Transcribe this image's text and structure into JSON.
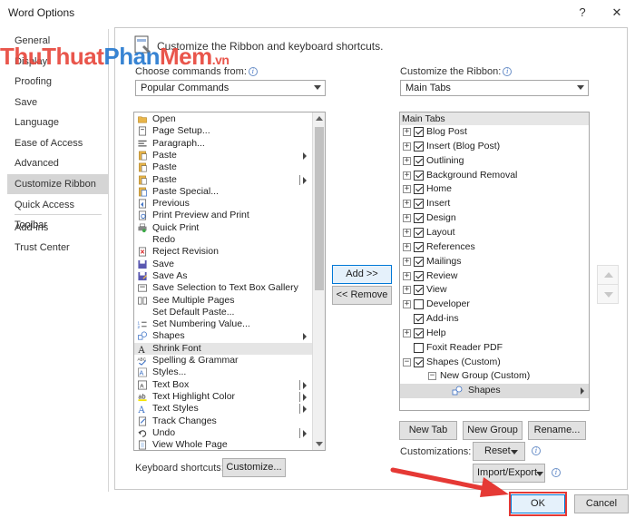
{
  "window": {
    "title": "Word Options",
    "help": "?",
    "close": "✕"
  },
  "nav": [
    {
      "label": "General"
    },
    {
      "label": "Display"
    },
    {
      "label": "Proofing"
    },
    {
      "label": "Save"
    },
    {
      "label": "Language"
    },
    {
      "label": "Ease of Access"
    },
    {
      "label": "Advanced"
    },
    {
      "label": "Customize Ribbon",
      "selected": true
    },
    {
      "label": "Quick Access Toolbar"
    },
    {
      "label": "Add-ins"
    },
    {
      "label": "Trust Center"
    }
  ],
  "header": {
    "text": "Customize the Ribbon and keyboard shortcuts."
  },
  "left": {
    "choose_label": "Choose commands from:",
    "choose_value": "Popular Commands",
    "commands": [
      {
        "label": "Open",
        "icon": "folder-icon"
      },
      {
        "label": "Page Setup...",
        "icon": "page-setup-icon"
      },
      {
        "label": "Paragraph...",
        "icon": "paragraph-icon"
      },
      {
        "label": "Paste",
        "icon": "paste-icon",
        "submenu": true
      },
      {
        "label": "Paste",
        "icon": "paste-icon"
      },
      {
        "label": "Paste",
        "icon": "paste-icon",
        "split": true
      },
      {
        "label": "Paste Special...",
        "icon": "paste-special-icon"
      },
      {
        "label": "Previous",
        "icon": "previous-icon"
      },
      {
        "label": "Print Preview and Print",
        "icon": "print-preview-icon"
      },
      {
        "label": "Quick Print",
        "icon": "quick-print-icon"
      },
      {
        "label": "Redo",
        "icon": "redo-icon"
      },
      {
        "label": "Reject Revision",
        "icon": "reject-icon"
      },
      {
        "label": "Save",
        "icon": "save-icon"
      },
      {
        "label": "Save As",
        "icon": "save-as-icon"
      },
      {
        "label": "Save Selection to Text Box Gallery",
        "icon": "textbox-gallery-icon"
      },
      {
        "label": "See Multiple Pages",
        "icon": "multiple-pages-icon"
      },
      {
        "label": "Set Default Paste...",
        "icon": ""
      },
      {
        "label": "Set Numbering Value...",
        "icon": "numbering-icon"
      },
      {
        "label": "Shapes",
        "icon": "shapes-icon",
        "submenu": true
      },
      {
        "label": "Shrink Font",
        "icon": "shrink-font-icon",
        "selected": true
      },
      {
        "label": "Spelling & Grammar",
        "icon": "spelling-icon"
      },
      {
        "label": "Styles...",
        "icon": "styles-icon"
      },
      {
        "label": "Text Box",
        "icon": "text-box-icon",
        "split": true
      },
      {
        "label": "Text Highlight Color",
        "icon": "highlight-icon",
        "split": true
      },
      {
        "label": "Text Styles",
        "icon": "text-styles-icon",
        "split": true
      },
      {
        "label": "Track Changes",
        "icon": "track-changes-icon"
      },
      {
        "label": "Undo",
        "icon": "undo-icon",
        "split": true
      },
      {
        "label": "View Whole Page",
        "icon": "whole-page-icon"
      }
    ],
    "keyboard_label": "Keyboard shortcuts:",
    "customize_button": "Customize..."
  },
  "middle": {
    "add_button": "Add >>",
    "remove_button": "<< Remove"
  },
  "right": {
    "customize_label": "Customize the Ribbon:",
    "customize_value": "Main Tabs",
    "tree_header": "Main Tabs",
    "tabs": [
      {
        "label": "Blog Post",
        "expander": "+",
        "checked": true
      },
      {
        "label": "Insert (Blog Post)",
        "expander": "+",
        "checked": true
      },
      {
        "label": "Outlining",
        "expander": "+",
        "checked": true
      },
      {
        "label": "Background Removal",
        "expander": "+",
        "checked": true
      },
      {
        "label": "Home",
        "expander": "+",
        "checked": true
      },
      {
        "label": "Insert",
        "expander": "+",
        "checked": true
      },
      {
        "label": "Design",
        "expander": "+",
        "checked": true
      },
      {
        "label": "Layout",
        "expander": "+",
        "checked": true
      },
      {
        "label": "References",
        "expander": "+",
        "checked": true
      },
      {
        "label": "Mailings",
        "expander": "+",
        "checked": true
      },
      {
        "label": "Review",
        "expander": "+",
        "checked": true
      },
      {
        "label": "View",
        "expander": "+",
        "checked": true
      },
      {
        "label": "Developer",
        "expander": "+",
        "checked": false
      },
      {
        "label": "Add-ins",
        "expander": "",
        "checked": true
      },
      {
        "label": "Help",
        "expander": "+",
        "checked": true
      },
      {
        "label": "Foxit Reader PDF",
        "expander": "",
        "checked": false
      },
      {
        "label": "Shapes (Custom)",
        "expander": "−",
        "checked": true
      }
    ],
    "group_label": "New Group (Custom)",
    "group_item": "Shapes",
    "new_tab": "New Tab",
    "new_group": "New Group",
    "rename": "Rename...",
    "customizations_label": "Customizations:",
    "reset_button": "Reset",
    "import_export_button": "Import/Export"
  },
  "footer": {
    "ok": "OK",
    "cancel": "Cancel"
  },
  "watermark": {
    "part1": "ThuThuat",
    "part2": "Phan",
    "part3": "Mem",
    "part4": ".vn"
  },
  "colors": {
    "selection": "#d5d5d5",
    "focus_border": "#0078d7",
    "annotation_red": "#e53935"
  }
}
